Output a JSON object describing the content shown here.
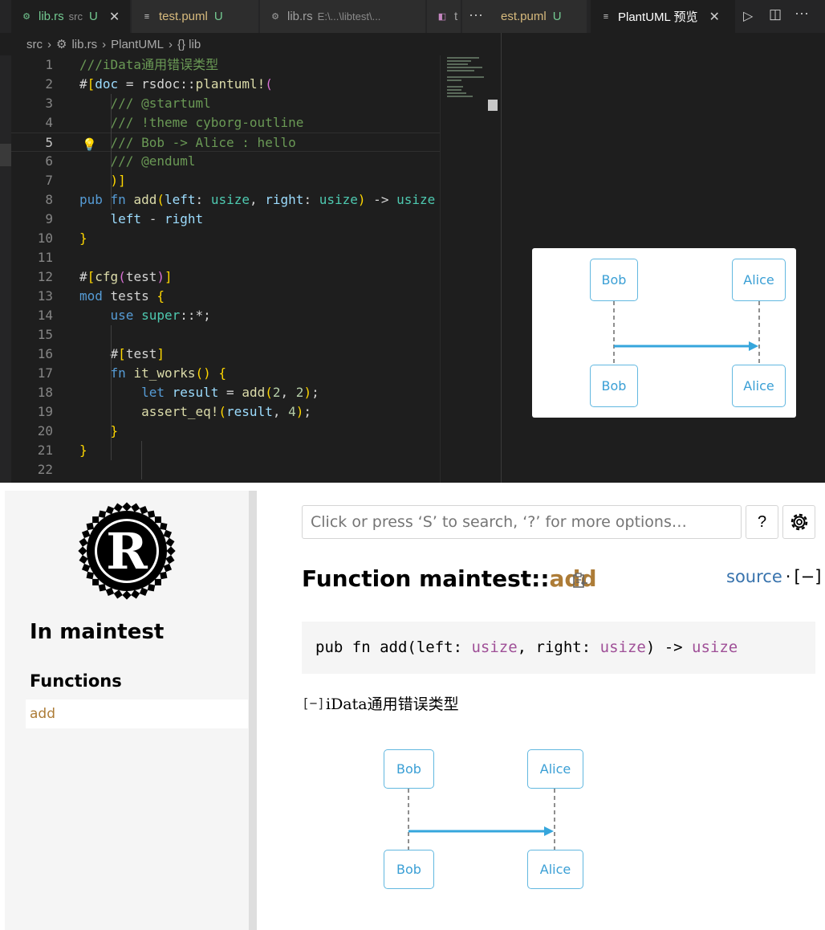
{
  "tabs": [
    {
      "label": "lib.rs",
      "extra": "src",
      "status": "U",
      "close": "✕"
    },
    {
      "label": "test.puml",
      "status": "U"
    },
    {
      "label": "lib.rs",
      "extra": "E:\\...\\libtest\\..."
    },
    {
      "label": "t"
    },
    {
      "label": "est.puml",
      "status": "U"
    },
    {
      "label": "PlantUML 预览",
      "close": "✕"
    }
  ],
  "toolbar": {
    "more": "···",
    "run": "▷",
    "split": "◫"
  },
  "breadcrumb": [
    "src",
    "lib.rs",
    "PlantUML",
    "{} lib"
  ],
  "code_lines": [
    {
      "n": "1",
      "t": "///iData通用错误类型"
    },
    {
      "n": "2",
      "t": "#[doc = rsdoc::plantuml!("
    },
    {
      "n": "3",
      "t": "    /// @startuml"
    },
    {
      "n": "4",
      "t": "    /// !theme cyborg-outline"
    },
    {
      "n": "5",
      "t": "    /// Bob -> Alice : hello"
    },
    {
      "n": "6",
      "t": "    /// @enduml"
    },
    {
      "n": "7",
      "t": "    )]"
    },
    {
      "n": "8",
      "t": "pub fn add(left: usize, right: usize) -> usize"
    },
    {
      "n": "9",
      "t": "    left - right"
    },
    {
      "n": "10",
      "t": "}"
    },
    {
      "n": "11",
      "t": ""
    },
    {
      "n": "12",
      "t": "#[cfg(test)]"
    },
    {
      "n": "13",
      "t": "mod tests {"
    },
    {
      "n": "14",
      "t": "    use super::*;"
    },
    {
      "n": "15",
      "t": ""
    },
    {
      "n": "16",
      "t": "    #[test]"
    },
    {
      "n": "17",
      "t": "    fn it_works() {"
    },
    {
      "n": "18",
      "t": "        let result = add(2, 2);"
    },
    {
      "n": "19",
      "t": "        assert_eq!(result, 4);"
    },
    {
      "n": "20",
      "t": "    }"
    },
    {
      "n": "21",
      "t": "}"
    },
    {
      "n": "22",
      "t": ""
    }
  ],
  "uml": {
    "actor_a": "Bob",
    "actor_b": "Alice"
  },
  "docs": {
    "sidebar_heading": "In maintest",
    "section_heading": "Functions",
    "items": [
      "add"
    ],
    "search_placeholder": "Click or press ‘S’ to search, ‘?’ for more options…",
    "help_label": "?",
    "title_prefix": "Function maintest::",
    "title_fn": "add",
    "source_label": "source",
    "source_sep": "·",
    "collapse_label": "[−]",
    "signature": {
      "p1": "pub fn add(left: ",
      "t1": "usize",
      "p2": ", right: ",
      "t2": "usize",
      "p3": ") -> ",
      "t3": "usize"
    },
    "doc_toggle": "[−]",
    "doc_text": "iData通用错误类型"
  },
  "colors": {
    "accent_fn": "#ad7c37",
    "link": "#3873ad",
    "type": "#9f4f97",
    "uml": "#3a9fd5"
  },
  "icons": [
    "rust-file-icon",
    "puml-file-icon",
    "preview-icon",
    "run-icon",
    "split-editor-icon",
    "lightbulb-icon",
    "rust-logo",
    "gear-icon",
    "copy-path-icon"
  ]
}
